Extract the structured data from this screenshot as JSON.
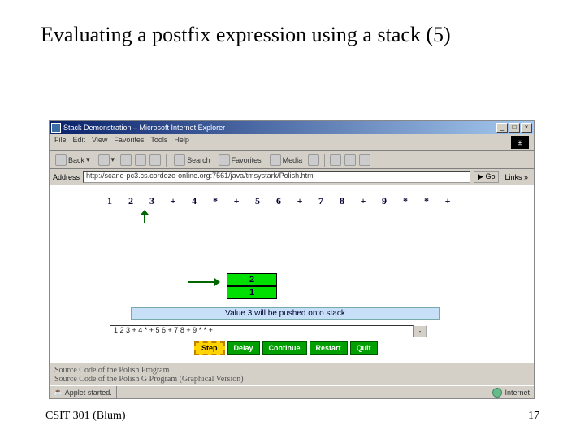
{
  "slide": {
    "title": "Evaluating a postfix expression using a stack (5)",
    "footer_left": "CSIT 301 (Blum)",
    "page_number": "17"
  },
  "browser": {
    "title": "Stack Demonstration – Microsoft Internet Explorer",
    "menus": [
      "File",
      "Edit",
      "View",
      "Favorites",
      "Tools",
      "Help"
    ],
    "toolbar": {
      "back": "Back",
      "search": "Search",
      "favorites": "Favorites",
      "media": "Media"
    },
    "address_label": "Address",
    "address_value": "http://scano-pc3.cs.cordozo-online.org:7561/java/tmsystark/Polish.html",
    "go_label": "Go",
    "links_label": "Links »",
    "status_left": "Applet started.",
    "status_net": "Internet"
  },
  "applet": {
    "tokens": [
      "1",
      "2",
      "3",
      "+",
      "4",
      "*",
      "+",
      "5",
      "6",
      "+",
      "7",
      "8",
      "+",
      "9",
      "*",
      "*",
      "+"
    ],
    "stack": [
      "2",
      "1"
    ],
    "message": "Value 3 will be pushed onto stack",
    "input_value": "1 2 3 + 4 * + 5 6 + 7 8 + 9 * * +",
    "buttons": {
      "step": "Step",
      "delay": "Delay",
      "continue": "Continue",
      "restart": "Restart",
      "quit": "Quit"
    },
    "src1": "Source Code of the Polish Program",
    "src2": "Source Code of the Polish G Program (Graphical Version)"
  }
}
